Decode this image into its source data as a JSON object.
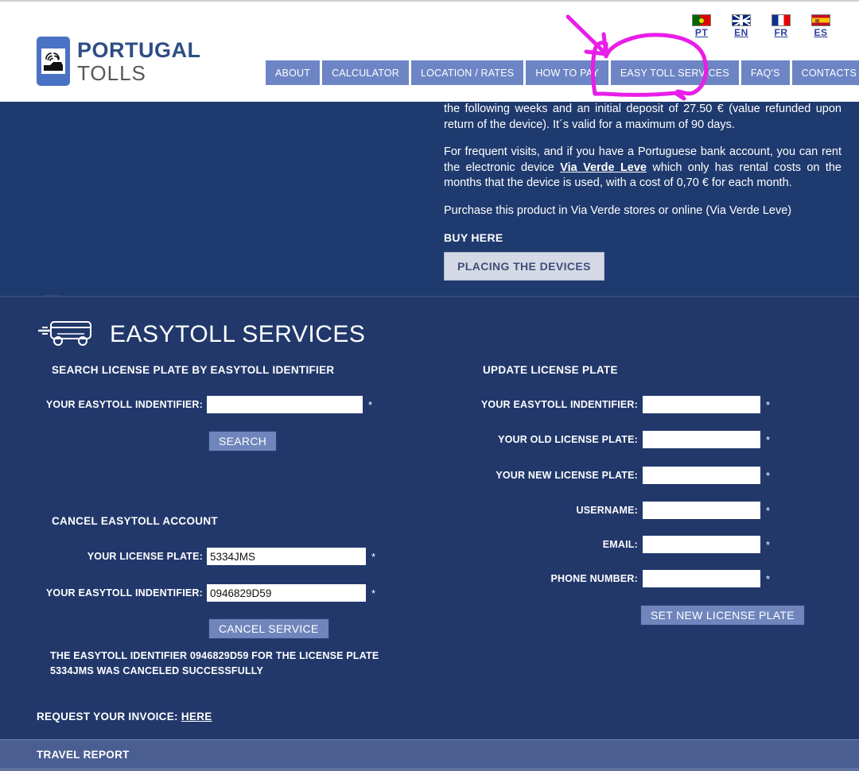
{
  "brand": {
    "name_line1": "PORTUGAL",
    "name_line2": "TOLLS",
    "logo_icon": "toll-gantry-car-icon"
  },
  "nav": {
    "items": [
      {
        "label": "ABOUT"
      },
      {
        "label": "CALCULATOR"
      },
      {
        "label": "LOCATION / RATES"
      },
      {
        "label": "HOW TO PAY"
      },
      {
        "label": "EASY TOLL SERVICES"
      },
      {
        "label": "FAQ'S"
      },
      {
        "label": "CONTACTS"
      }
    ]
  },
  "languages": [
    {
      "code": "PT",
      "flag": "portugal-flag-icon"
    },
    {
      "code": "EN",
      "flag": "united-kingdom-flag-icon"
    },
    {
      "code": "FR",
      "flag": "france-flag-icon"
    },
    {
      "code": "ES",
      "flag": "spain-flag-icon"
    }
  ],
  "intro": {
    "paragraph1": "the following weeks and an initial deposit of 27.50 € (value refunded upon return of the device). It´s valid for a maximum of 90 days.",
    "paragraph2_before": "For frequent visits, and if you have a Portuguese bank account, you can rent the electronic device ",
    "paragraph2_link": "Via Verde Leve",
    "paragraph2_after": " which only has rental costs on the months that the device is used, with a cost  of 0,70 € for each month.",
    "paragraph3": "Purchase this product in Via Verde stores or online (Via Verde Leve)",
    "buy_here_label": "BUY HERE",
    "placing_devices_button": "PLACING THE DEVICES"
  },
  "section": {
    "title": "EASYTOLL SERVICES",
    "icon": "easytoll-card-on-wheels-icon"
  },
  "search_form": {
    "heading": "SEARCH LICENSE PLATE BY EASYTOLL IDENTIFIER",
    "identifier_label": "YOUR EASYTOLL INDENTIFIER:",
    "identifier_value": "",
    "required_mark": "*",
    "submit_label": "SEARCH"
  },
  "cancel_form": {
    "heading": "CANCEL EASYTOLL ACCOUNT",
    "plate_label": "YOUR LICENSE PLATE:",
    "plate_value": "5334JMS",
    "identifier_label": "YOUR EASYTOLL INDENTIFIER:",
    "identifier_value": "0946829D59",
    "required_mark": "*",
    "submit_label": "CANCEL SERVICE",
    "status_message": "THE EASYTOLL IDENTIFIER 0946829D59 FOR THE LICENSE PLATE 5334JMS WAS CANCELED SUCCESSFULLY"
  },
  "update_form": {
    "heading": "UPDATE LICENSE PLATE",
    "required_mark": "*",
    "fields": [
      {
        "label": "YOUR EASYTOLL INDENTIFIER:",
        "value": ""
      },
      {
        "label": "YOUR OLD LICENSE PLATE:",
        "value": ""
      },
      {
        "label": "YOUR NEW LICENSE PLATE:",
        "value": ""
      },
      {
        "label": "USERNAME:",
        "value": ""
      },
      {
        "label": "EMAIL:",
        "value": ""
      },
      {
        "label": "PHONE NUMBER:",
        "value": ""
      }
    ],
    "submit_label": "SET NEW LICENSE PLATE"
  },
  "invoice": {
    "label": "REQUEST YOUR INVOICE:",
    "link_label": "HERE"
  },
  "travel_report": {
    "label": "TRAVEL REPORT"
  },
  "annotation": {
    "color": "#e81ee8",
    "shape": "arrow-and-ellipse-highlight",
    "target": "EASY TOLL SERVICES"
  },
  "colors": {
    "header_bg": "#ffffff",
    "panel_dark_blue": "#1f3a6e",
    "panel_main_blue": "#22386b",
    "nav_button": "#6d85c5",
    "form_button": "#6f85bc",
    "travel_bar": "#4a5e92",
    "brand_blue": "#2e4d86",
    "annotation_pink": "#e81ee8"
  }
}
